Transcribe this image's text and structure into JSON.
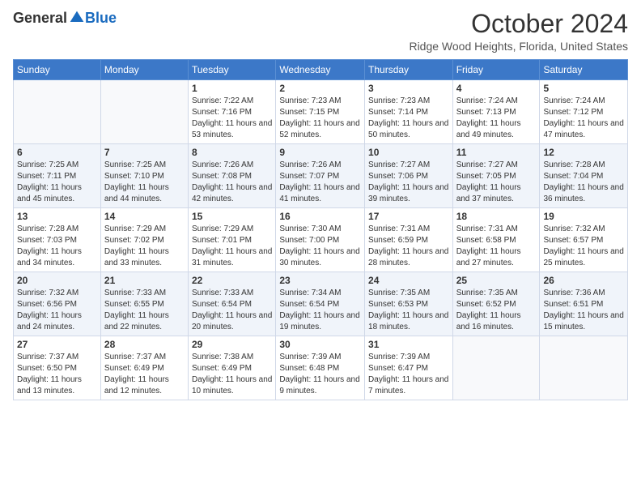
{
  "logo": {
    "general": "General",
    "blue": "Blue"
  },
  "header": {
    "month": "October 2024",
    "location": "Ridge Wood Heights, Florida, United States"
  },
  "weekdays": [
    "Sunday",
    "Monday",
    "Tuesday",
    "Wednesday",
    "Thursday",
    "Friday",
    "Saturday"
  ],
  "weeks": [
    [
      {
        "day": "",
        "sunrise": "",
        "sunset": "",
        "daylight": ""
      },
      {
        "day": "",
        "sunrise": "",
        "sunset": "",
        "daylight": ""
      },
      {
        "day": "1",
        "sunrise": "Sunrise: 7:22 AM",
        "sunset": "Sunset: 7:16 PM",
        "daylight": "Daylight: 11 hours and 53 minutes."
      },
      {
        "day": "2",
        "sunrise": "Sunrise: 7:23 AM",
        "sunset": "Sunset: 7:15 PM",
        "daylight": "Daylight: 11 hours and 52 minutes."
      },
      {
        "day": "3",
        "sunrise": "Sunrise: 7:23 AM",
        "sunset": "Sunset: 7:14 PM",
        "daylight": "Daylight: 11 hours and 50 minutes."
      },
      {
        "day": "4",
        "sunrise": "Sunrise: 7:24 AM",
        "sunset": "Sunset: 7:13 PM",
        "daylight": "Daylight: 11 hours and 49 minutes."
      },
      {
        "day": "5",
        "sunrise": "Sunrise: 7:24 AM",
        "sunset": "Sunset: 7:12 PM",
        "daylight": "Daylight: 11 hours and 47 minutes."
      }
    ],
    [
      {
        "day": "6",
        "sunrise": "Sunrise: 7:25 AM",
        "sunset": "Sunset: 7:11 PM",
        "daylight": "Daylight: 11 hours and 45 minutes."
      },
      {
        "day": "7",
        "sunrise": "Sunrise: 7:25 AM",
        "sunset": "Sunset: 7:10 PM",
        "daylight": "Daylight: 11 hours and 44 minutes."
      },
      {
        "day": "8",
        "sunrise": "Sunrise: 7:26 AM",
        "sunset": "Sunset: 7:08 PM",
        "daylight": "Daylight: 11 hours and 42 minutes."
      },
      {
        "day": "9",
        "sunrise": "Sunrise: 7:26 AM",
        "sunset": "Sunset: 7:07 PM",
        "daylight": "Daylight: 11 hours and 41 minutes."
      },
      {
        "day": "10",
        "sunrise": "Sunrise: 7:27 AM",
        "sunset": "Sunset: 7:06 PM",
        "daylight": "Daylight: 11 hours and 39 minutes."
      },
      {
        "day": "11",
        "sunrise": "Sunrise: 7:27 AM",
        "sunset": "Sunset: 7:05 PM",
        "daylight": "Daylight: 11 hours and 37 minutes."
      },
      {
        "day": "12",
        "sunrise": "Sunrise: 7:28 AM",
        "sunset": "Sunset: 7:04 PM",
        "daylight": "Daylight: 11 hours and 36 minutes."
      }
    ],
    [
      {
        "day": "13",
        "sunrise": "Sunrise: 7:28 AM",
        "sunset": "Sunset: 7:03 PM",
        "daylight": "Daylight: 11 hours and 34 minutes."
      },
      {
        "day": "14",
        "sunrise": "Sunrise: 7:29 AM",
        "sunset": "Sunset: 7:02 PM",
        "daylight": "Daylight: 11 hours and 33 minutes."
      },
      {
        "day": "15",
        "sunrise": "Sunrise: 7:29 AM",
        "sunset": "Sunset: 7:01 PM",
        "daylight": "Daylight: 11 hours and 31 minutes."
      },
      {
        "day": "16",
        "sunrise": "Sunrise: 7:30 AM",
        "sunset": "Sunset: 7:00 PM",
        "daylight": "Daylight: 11 hours and 30 minutes."
      },
      {
        "day": "17",
        "sunrise": "Sunrise: 7:31 AM",
        "sunset": "Sunset: 6:59 PM",
        "daylight": "Daylight: 11 hours and 28 minutes."
      },
      {
        "day": "18",
        "sunrise": "Sunrise: 7:31 AM",
        "sunset": "Sunset: 6:58 PM",
        "daylight": "Daylight: 11 hours and 27 minutes."
      },
      {
        "day": "19",
        "sunrise": "Sunrise: 7:32 AM",
        "sunset": "Sunset: 6:57 PM",
        "daylight": "Daylight: 11 hours and 25 minutes."
      }
    ],
    [
      {
        "day": "20",
        "sunrise": "Sunrise: 7:32 AM",
        "sunset": "Sunset: 6:56 PM",
        "daylight": "Daylight: 11 hours and 24 minutes."
      },
      {
        "day": "21",
        "sunrise": "Sunrise: 7:33 AM",
        "sunset": "Sunset: 6:55 PM",
        "daylight": "Daylight: 11 hours and 22 minutes."
      },
      {
        "day": "22",
        "sunrise": "Sunrise: 7:33 AM",
        "sunset": "Sunset: 6:54 PM",
        "daylight": "Daylight: 11 hours and 20 minutes."
      },
      {
        "day": "23",
        "sunrise": "Sunrise: 7:34 AM",
        "sunset": "Sunset: 6:54 PM",
        "daylight": "Daylight: 11 hours and 19 minutes."
      },
      {
        "day": "24",
        "sunrise": "Sunrise: 7:35 AM",
        "sunset": "Sunset: 6:53 PM",
        "daylight": "Daylight: 11 hours and 18 minutes."
      },
      {
        "day": "25",
        "sunrise": "Sunrise: 7:35 AM",
        "sunset": "Sunset: 6:52 PM",
        "daylight": "Daylight: 11 hours and 16 minutes."
      },
      {
        "day": "26",
        "sunrise": "Sunrise: 7:36 AM",
        "sunset": "Sunset: 6:51 PM",
        "daylight": "Daylight: 11 hours and 15 minutes."
      }
    ],
    [
      {
        "day": "27",
        "sunrise": "Sunrise: 7:37 AM",
        "sunset": "Sunset: 6:50 PM",
        "daylight": "Daylight: 11 hours and 13 minutes."
      },
      {
        "day": "28",
        "sunrise": "Sunrise: 7:37 AM",
        "sunset": "Sunset: 6:49 PM",
        "daylight": "Daylight: 11 hours and 12 minutes."
      },
      {
        "day": "29",
        "sunrise": "Sunrise: 7:38 AM",
        "sunset": "Sunset: 6:49 PM",
        "daylight": "Daylight: 11 hours and 10 minutes."
      },
      {
        "day": "30",
        "sunrise": "Sunrise: 7:39 AM",
        "sunset": "Sunset: 6:48 PM",
        "daylight": "Daylight: 11 hours and 9 minutes."
      },
      {
        "day": "31",
        "sunrise": "Sunrise: 7:39 AM",
        "sunset": "Sunset: 6:47 PM",
        "daylight": "Daylight: 11 hours and 7 minutes."
      },
      {
        "day": "",
        "sunrise": "",
        "sunset": "",
        "daylight": ""
      },
      {
        "day": "",
        "sunrise": "",
        "sunset": "",
        "daylight": ""
      }
    ]
  ]
}
